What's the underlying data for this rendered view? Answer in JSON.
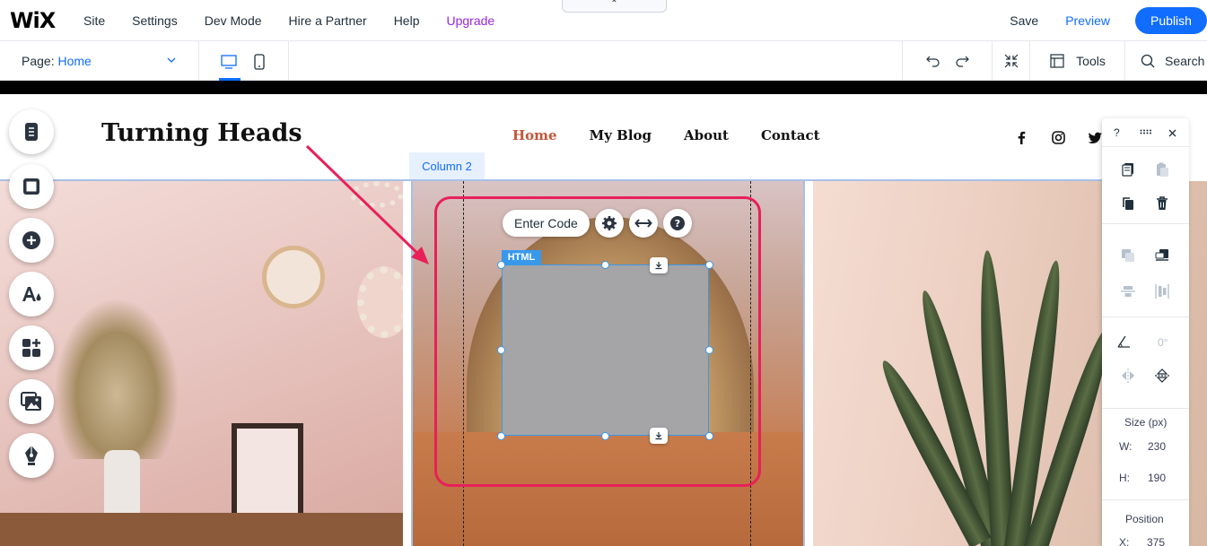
{
  "app": {
    "logo": "WiX",
    "menu": [
      "Site",
      "Settings",
      "Dev Mode",
      "Hire a Partner",
      "Help",
      "Upgrade"
    ],
    "collapse_icon": "chevron-up-icon",
    "save_label": "Save",
    "preview_label": "Preview",
    "publish_label": "Publish",
    "accent": "#116dff",
    "upgrade_color": "#9a27d5"
  },
  "toolbar": {
    "page_prefix": "Page:",
    "page_value": "Home",
    "tools_label": "Tools",
    "search_label": "Search"
  },
  "site": {
    "title": "Turning Heads",
    "nav": [
      "Home",
      "My Blog",
      "About",
      "Contact"
    ],
    "active_color": "#c0573b",
    "social": [
      "facebook-icon",
      "instagram-icon",
      "twitter-icon"
    ]
  },
  "editor": {
    "column_tab": "Column 2",
    "element_tag": "HTML",
    "enter_code_label": "Enter Code",
    "highlight_color": "#e8205a"
  },
  "panel": {
    "help": "?",
    "size_title": "Size (px)",
    "w_label": "W:",
    "w_value": "230",
    "h_label": "H:",
    "h_value": "190",
    "rotation": "0°",
    "position_title": "Position",
    "x_label": "X:",
    "x_value": "375"
  }
}
